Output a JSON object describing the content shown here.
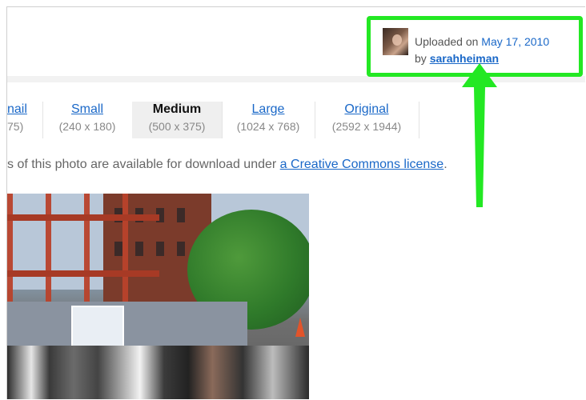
{
  "uploader": {
    "prefix": "Uploaded on ",
    "date": "May 17, 2010",
    "by_prefix": "by ",
    "username": "sarahheiman"
  },
  "sizes": [
    {
      "label": "nail",
      "dims": "75)",
      "active": false
    },
    {
      "label": "Small",
      "dims": "(240 x 180)",
      "active": false
    },
    {
      "label": "Medium",
      "dims": "(500 x 375)",
      "active": true
    },
    {
      "label": "Large",
      "dims": "(1024 x 768)",
      "active": false
    },
    {
      "label": "Original",
      "dims": "(2592 x 1944)",
      "active": false
    }
  ],
  "notice": {
    "text": "s of this photo are available for download under ",
    "link": "a Creative Commons license",
    "suffix": "."
  },
  "highlight_color": "#23e823",
  "link_color": "#1a68c8"
}
